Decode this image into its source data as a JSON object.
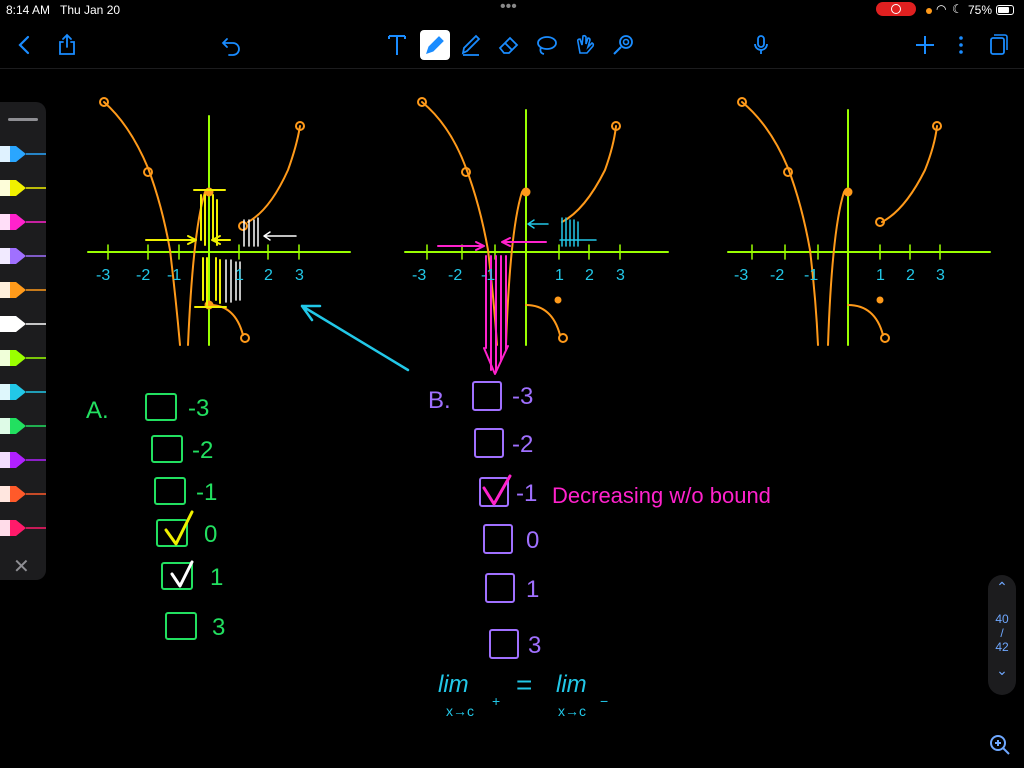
{
  "status_bar": {
    "time": "8:14 AM",
    "date": "Thu Jan 20",
    "battery": "75%"
  },
  "toolbar": {
    "left_icons": [
      "back-icon",
      "share-icon",
      "undo-icon"
    ],
    "tool_icons": [
      "text-tool-icon",
      "pen-tool-icon",
      "highlighter-tool-icon",
      "eraser-tool-icon",
      "lasso-tool-icon",
      "shapes-tool-icon",
      "laser-pointer-icon"
    ],
    "right_icons": [
      "microphone-icon",
      "add-icon",
      "more-icon",
      "pages-icon"
    ],
    "accent": "#1a8cff"
  },
  "pen_palette": {
    "colors": [
      "#2aa6ff",
      "#f0f000",
      "#ff22cc",
      "#a070ff",
      "#ff9a1a",
      "#ffffff",
      "#9aff00",
      "#22c8e8",
      "#22e060",
      "#b020ff",
      "#ff5a2a",
      "#ff1a6a"
    ],
    "close_icon": "close-icon"
  },
  "page_nav": {
    "current": "40",
    "separator": "/",
    "total": "42"
  },
  "notes": {
    "axis_ticks_x": [
      "-3",
      "-2",
      "-1",
      "1",
      "2",
      "3"
    ],
    "question_a": {
      "label": "A.",
      "options": [
        "-3",
        "-2",
        "-1",
        "0",
        "1",
        "3"
      ],
      "checked": [
        "0",
        "1"
      ]
    },
    "question_b": {
      "label": "B.",
      "options": [
        "-3",
        "-2",
        "-1",
        "0",
        "1",
        "3"
      ],
      "checked": [
        "-1"
      ],
      "note": "Decreasing w/o bound"
    },
    "limit_left": "lim",
    "limit_left_sub": "x→c",
    "limit_left_sup": "+",
    "equals": "=",
    "limit_right": "lim",
    "limit_right_sub": "x→c",
    "limit_right_sup": "−"
  }
}
